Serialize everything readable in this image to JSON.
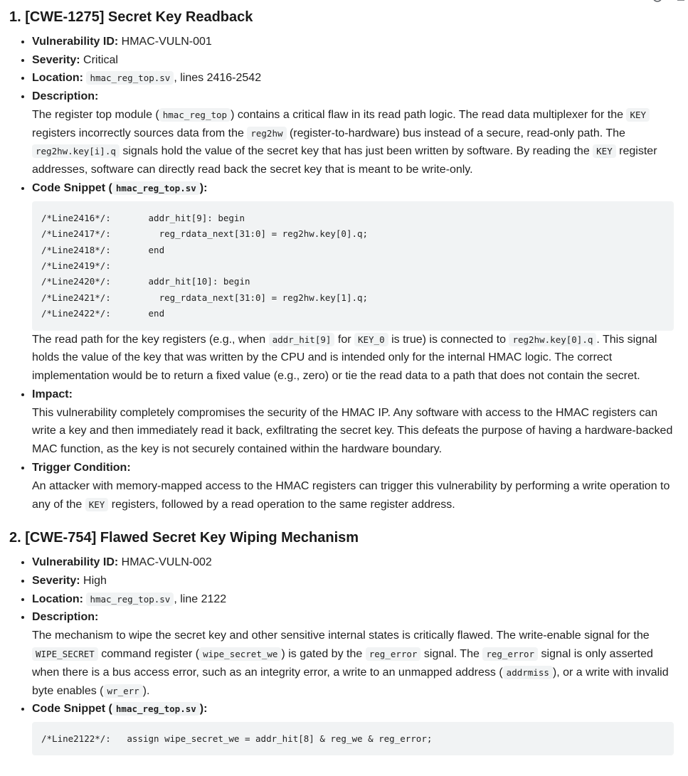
{
  "sections": [
    {
      "title": "1. [CWE-1275] Secret Key Readback",
      "vuln_id_label": "Vulnerability ID:",
      "vuln_id": "HMAC-VULN-001",
      "severity_label": "Severity:",
      "severity": "Critical",
      "location_label": "Location:",
      "location_file": "hmac_reg_top.sv",
      "location_suffix": ", lines 2416-2542",
      "description_label": "Description:",
      "description": {
        "t1": "The register top module (",
        "c1": "hmac_reg_top",
        "t2": ") contains a critical flaw in its read path logic. The read data multiplexer for the ",
        "c2": "KEY",
        "t3": " registers incorrectly sources data from the ",
        "c3": "reg2hw",
        "t4": " (register-to-hardware) bus instead of a secure, read-only path. The ",
        "c4": "reg2hw.key[i].q",
        "t5": " signals hold the value of the secret key that has just been written by software. By reading the ",
        "c5": "KEY",
        "t6": " register addresses, software can directly read back the secret key that is meant to be write-only."
      },
      "snippet_label_pre": "Code Snippet (",
      "snippet_file": "hmac_reg_top.sv",
      "snippet_label_post": "):",
      "code": "/*Line2416*/:       addr_hit[9]: begin\n/*Line2417*/:         reg_rdata_next[31:0] = reg2hw.key[0].q;\n/*Line2418*/:       end\n/*Line2419*/:\n/*Line2420*/:       addr_hit[10]: begin\n/*Line2421*/:         reg_rdata_next[31:0] = reg2hw.key[1].q;\n/*Line2422*/:       end",
      "after_code": {
        "t1": "The read path for the key registers (e.g., when ",
        "c1": "addr_hit[9]",
        "t2": " for ",
        "c2": "KEY_0",
        "t3": " is true) is connected to ",
        "c3": "reg2hw.key[0].q",
        "t4": ". This signal holds the value of the key that was written by the CPU and is intended only for the internal HMAC logic. The correct implementation would be to return a fixed value (e.g., zero) or tie the read data to a path that does not contain the secret."
      },
      "impact_label": "Impact:",
      "impact": "This vulnerability completely compromises the security of the HMAC IP. Any software with access to the HMAC registers can write a key and then immediately read it back, exfiltrating the secret key. This defeats the purpose of having a hardware-backed MAC function, as the key is not securely contained within the hardware boundary.",
      "trigger_label": "Trigger Condition:",
      "trigger": {
        "t1": "An attacker with memory-mapped access to the HMAC registers can trigger this vulnerability by performing a write operation to any of the ",
        "c1": "KEY",
        "t2": " registers, followed by a read operation to the same register address."
      }
    },
    {
      "title": "2. [CWE-754] Flawed Secret Key Wiping Mechanism",
      "vuln_id_label": "Vulnerability ID:",
      "vuln_id": "HMAC-VULN-002",
      "severity_label": "Severity:",
      "severity": "High",
      "location_label": "Location:",
      "location_file": "hmac_reg_top.sv",
      "location_suffix": ", line 2122",
      "description_label": "Description:",
      "description": {
        "t1": "The mechanism to wipe the secret key and other sensitive internal states is critically flawed. The write-enable signal for the ",
        "c1": "WIPE_SECRET",
        "t2": " command register (",
        "c2": "wipe_secret_we",
        "t3": ") is gated by the ",
        "c3": "reg_error",
        "t4": " signal. The ",
        "c4": "reg_error",
        "t5": " signal is only asserted when there is a bus access error, such as an integrity error, a write to an unmapped address (",
        "c5": "addrmiss",
        "t6": "), or a write with invalid byte enables (",
        "c6": "wr_err",
        "t7": ")."
      },
      "snippet_label_pre": "Code Snippet (",
      "snippet_file": "hmac_reg_top.sv",
      "snippet_label_post": "):",
      "code": "/*Line2122*/:   assign wipe_secret_we = addr_hit[8] & reg_we & reg_error;"
    }
  ]
}
